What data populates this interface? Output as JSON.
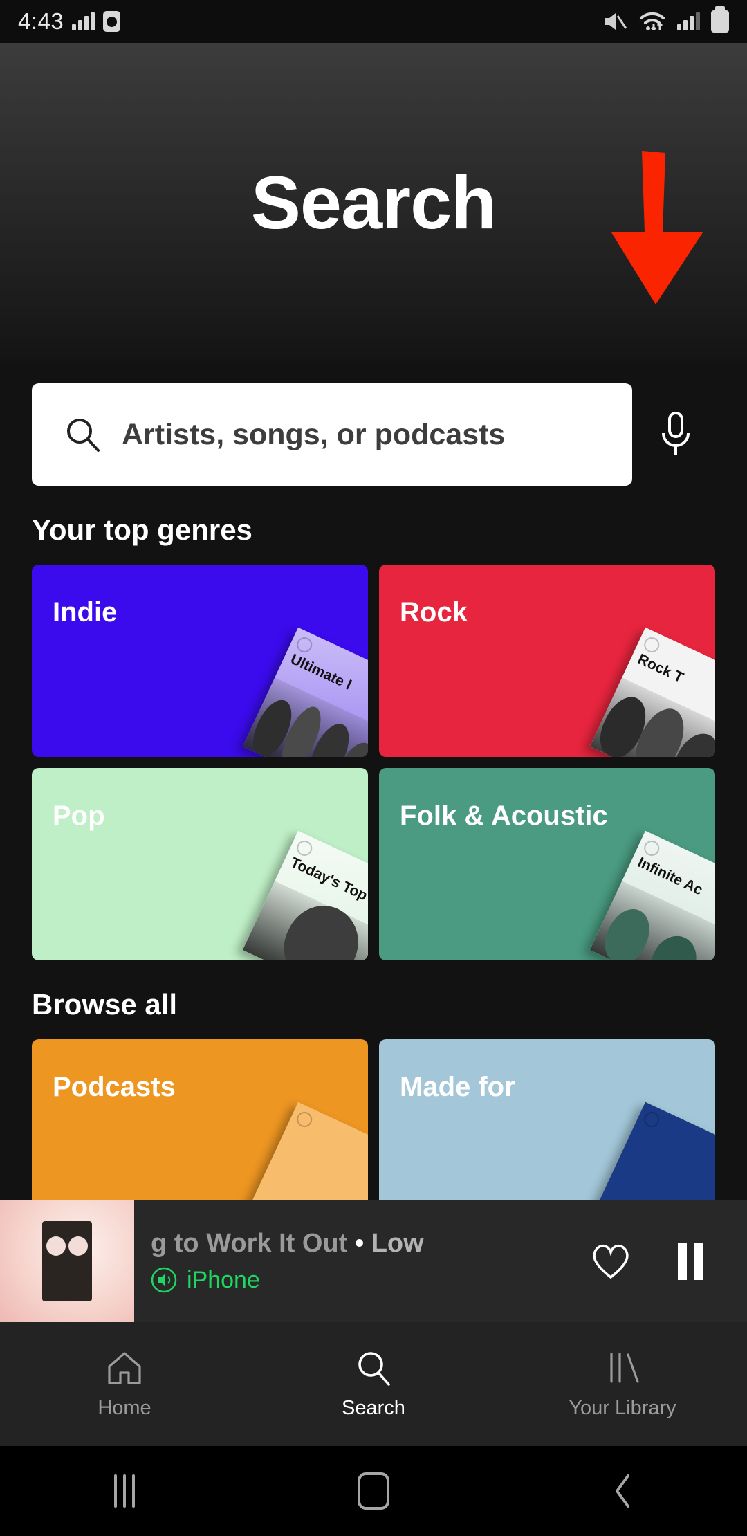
{
  "status_bar": {
    "time": "4:43",
    "left_icons": [
      "signal-bars-icon",
      "alarm-clock-icon"
    ],
    "right_icons": [
      "mute-icon",
      "wifi-icon",
      "signal-bars-icon",
      "battery-icon"
    ]
  },
  "header": {
    "title": "Search"
  },
  "annotation": {
    "type": "arrow-down",
    "color": "#FA2400",
    "points_to": "voice-search-mic-button"
  },
  "search": {
    "placeholder": "Artists, songs, or podcasts",
    "icon": "search-icon",
    "mic_icon": "microphone-icon",
    "background": "#FFFFFF"
  },
  "top_genres": {
    "title": "Your top genres",
    "cards": [
      {
        "label": "Indie",
        "color": "#3B0BEE",
        "cover_title": "Ultimate I",
        "cover_bg": "#b9a8f5"
      },
      {
        "label": "Rock",
        "color": "#E8253E",
        "cover_title": "Rock T",
        "cover_bg": "#f2f2f2"
      },
      {
        "label": "Pop",
        "color": "#BFEFC6",
        "cover_title": "Today's Top H",
        "cover_bg": "#eef7ef"
      },
      {
        "label": "Folk & Acoustic",
        "color": "#4A9B81",
        "cover_title": "Infinite Ac",
        "cover_bg": "#e9f2ed"
      }
    ]
  },
  "browse_all": {
    "title": "Browse all",
    "cards": [
      {
        "label": "Podcasts",
        "color": "#EE9622"
      },
      {
        "label": "Made for",
        "color": "#A3C7D8"
      }
    ]
  },
  "now_playing": {
    "title_clipped": "g to Work It Out",
    "separator": "•",
    "artist": "Low",
    "device_label": "iPhone",
    "device_icon": "speaker-icon",
    "device_color": "#1ED760",
    "like_icon": "heart-outline-icon",
    "play_state_icon": "pause-icon"
  },
  "bottom_tabs": [
    {
      "label": "Home",
      "icon": "home-icon",
      "active": false
    },
    {
      "label": "Search",
      "icon": "search-icon",
      "active": true
    },
    {
      "label": "Your Library",
      "icon": "library-icon",
      "active": false
    }
  ],
  "android_nav": [
    {
      "name": "recents-button",
      "icon": "recents-icon"
    },
    {
      "name": "home-button",
      "icon": "home-square-icon"
    },
    {
      "name": "back-button",
      "icon": "chevron-left-icon"
    }
  ]
}
